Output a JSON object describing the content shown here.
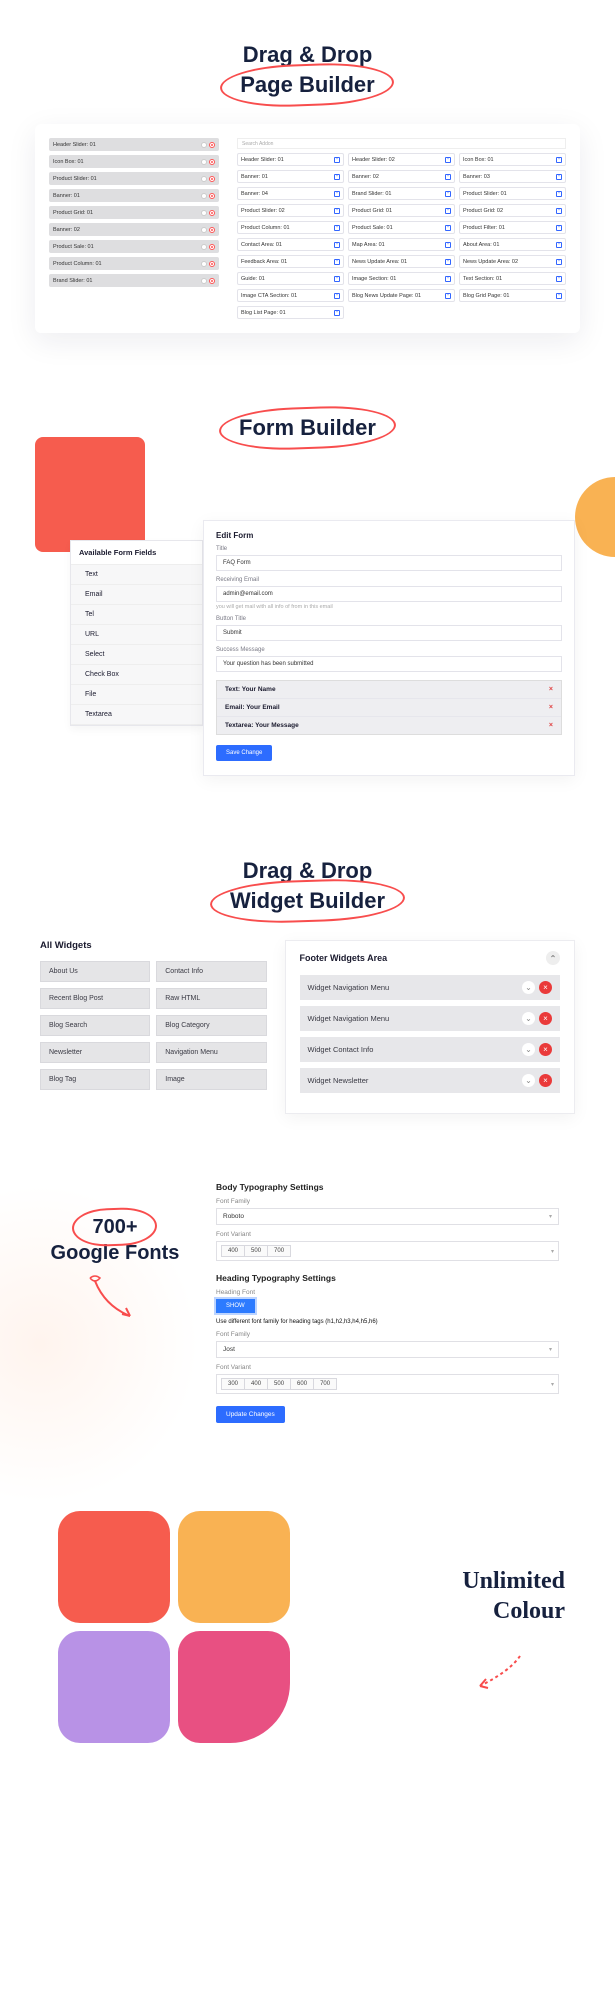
{
  "page_builder": {
    "title_line1": "Drag & Drop",
    "title_line2": "Page Builder",
    "search_placeholder": "Search Addon",
    "left_items": [
      "Header Slider: 01",
      "Icon Box: 01",
      "Product Slider: 01",
      "Banner: 01",
      "Product Grid: 01",
      "Banner: 02",
      "Product Sale: 01",
      "Product Column: 01",
      "Brand Slider: 01"
    ],
    "right_items": [
      "Header Slider: 01",
      "Header Slider: 02",
      "Icon Box: 01",
      "Banner: 01",
      "Banner: 02",
      "Banner: 03",
      "Banner: 04",
      "Brand Slider: 01",
      "Product Slider: 01",
      "Product Slider: 02",
      "Product Grid: 01",
      "Product Grid: 02",
      "Product Column: 01",
      "Product Sale: 01",
      "Product Filter: 01",
      "Contact Area: 01",
      "Map Area: 01",
      "About Area: 01",
      "Feedback Area: 01",
      "News Update Area: 01",
      "News Update Area: 02",
      "Guide: 01",
      "Image Section: 01",
      "Text Section: 01",
      "Image CTA Section: 01",
      "Blog News Update Page: 01",
      "Blog Grid Page: 01",
      "Blog List Page: 01"
    ]
  },
  "form_builder": {
    "title": "Form Builder",
    "fields_header": "Available Form Fields",
    "fields": [
      "Text",
      "Email",
      "Tel",
      "URL",
      "Select",
      "Check Box",
      "File",
      "Textarea"
    ],
    "edit_title": "Edit Form",
    "label_title": "Title",
    "val_title": "FAQ Form",
    "label_email": "Receiving Email",
    "val_email": "admin@email.com",
    "hint_email": "you will get mail with all info of from in this email",
    "label_btn": "Button Title",
    "val_btn": "Submit",
    "label_success": "Success Message",
    "val_success": "Your question has been submitted",
    "rows": [
      "Text: Your Name",
      "Email: Your Email",
      "Textarea: Your Message"
    ],
    "save": "Save Change"
  },
  "widget_builder": {
    "title_line1": "Drag & Drop",
    "title_line2": "Widget Builder",
    "left_header": "All Widgets",
    "widgets": [
      "About Us",
      "Contact Info",
      "Recent Blog Post",
      "Raw HTML",
      "Blog Search",
      "Blog Category",
      "Newsletter",
      "Navigation Menu",
      "Blog Tag",
      "Image"
    ],
    "right_header": "Footer Widgets Area",
    "rows": [
      "Widget Navigation Menu",
      "Widget Navigation Menu",
      "Widget Contact Info",
      "Widget Newsletter"
    ]
  },
  "google_fonts": {
    "title_line1": "700+",
    "title_line2": "Google Fonts",
    "body_header": "Body Typography Settings",
    "label_family": "Font Family",
    "body_family": "Roboto",
    "label_variant": "Font Variant",
    "body_variants": [
      "400",
      "500",
      "700"
    ],
    "heading_header": "Heading Typography Settings",
    "label_heading_font": "Heading Font",
    "show": "SHOW",
    "hint": "Use different font family for heading tags (h1,h2,h3,h4,h5,h6)",
    "heading_family": "Jost",
    "heading_variants": [
      "300",
      "400",
      "500",
      "600",
      "700"
    ],
    "update": "Update Changes"
  },
  "colour": {
    "line1": "Unlimited",
    "line2": "Colour"
  }
}
